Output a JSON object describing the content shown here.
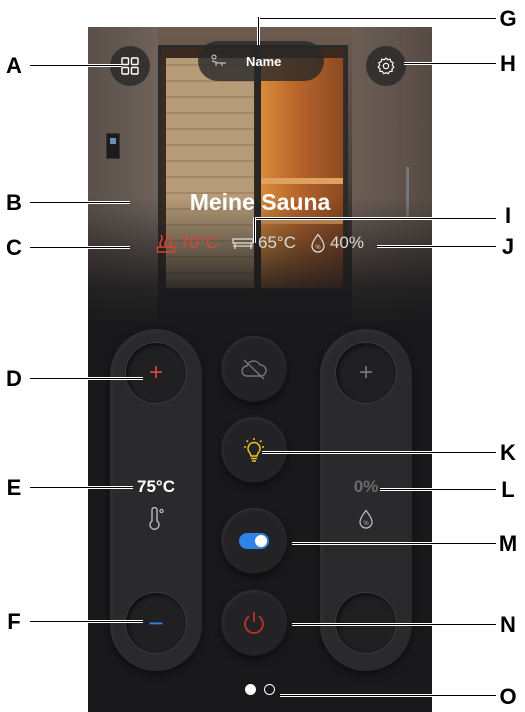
{
  "header": {
    "name_label": "Name"
  },
  "sauna": {
    "title": "Meine Sauna",
    "stats": {
      "heater_temp": "70°C",
      "bench_temp": "65°C",
      "humidity": "40%"
    }
  },
  "controls": {
    "temperature": {
      "value": "75°C",
      "plus_symbol": "+",
      "minus_symbol": "−"
    },
    "humidity": {
      "value": "0%",
      "plus_symbol": "+"
    },
    "toggle_on": true,
    "colors": {
      "heat": "#d8453a",
      "cool": "#2f82e8",
      "light": "#f0c020",
      "power": "#c0302a"
    }
  },
  "pager": {
    "pages": 2,
    "current": 1
  },
  "annotations": {
    "A": "A",
    "B": "B",
    "C": "C",
    "D": "D",
    "E": "E",
    "F": "F",
    "G": "G",
    "H": "H",
    "I": "I",
    "J": "J",
    "K": "K",
    "L": "L",
    "M": "M",
    "N": "N",
    "O": "O"
  }
}
